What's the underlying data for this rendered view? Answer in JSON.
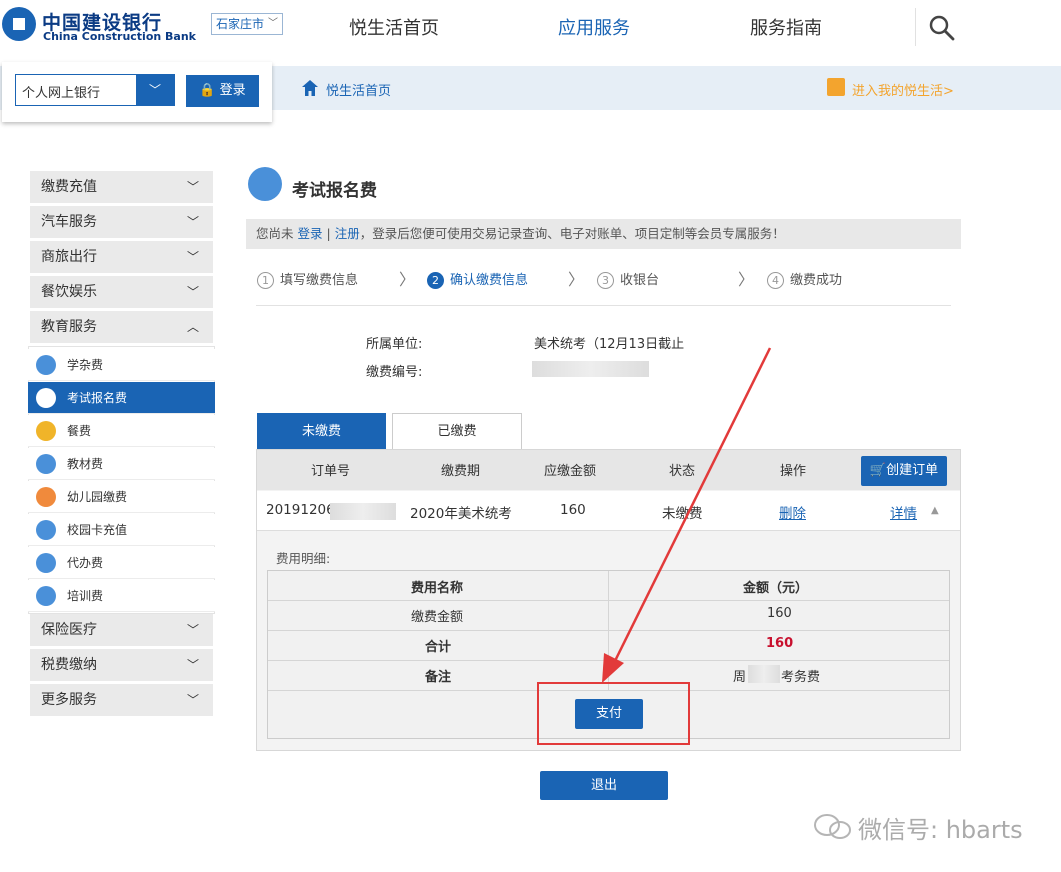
{
  "header": {
    "logo_cn": "中国建设银行",
    "logo_en": "China Construction Bank",
    "city": "石家庄市",
    "nav": [
      "悦生活首页",
      "应用服务",
      "服务指南"
    ]
  },
  "subbar": {
    "bank_type": "个人网上银行",
    "login": "登录",
    "home": "悦生活首页",
    "my_life": "进入我的悦生活>"
  },
  "sidebar": {
    "groups_top": [
      "缴费充值",
      "汽车服务",
      "商旅出行",
      "餐饮娱乐",
      "教育服务"
    ],
    "edu_items": [
      "学杂费",
      "考试报名费",
      "餐费",
      "教材费",
      "幼儿园缴费",
      "校园卡充值",
      "代办费",
      "培训费"
    ],
    "groups_bottom": [
      "保险医疗",
      "税费缴纳",
      "更多服务"
    ]
  },
  "page": {
    "title": "考试报名费",
    "notice_pre": "您尚未",
    "notice_login": "登录",
    "notice_sep": "|",
    "notice_register": "注册",
    "notice_post": "，登录后您便可使用交易记录查询、电子对账单、项目定制等会员专属服务！"
  },
  "steps": [
    {
      "num": "1",
      "label": "填写缴费信息"
    },
    {
      "num": "2",
      "label": "确认缴费信息"
    },
    {
      "num": "3",
      "label": "收银台"
    },
    {
      "num": "4",
      "label": "缴费成功"
    }
  ],
  "info": {
    "unit_label": "所属单位:",
    "unit_value": "美术统考（12月13日截止",
    "code_label": "缴费编号:"
  },
  "tabs": {
    "unpaid": "未缴费",
    "paid": "已缴费"
  },
  "table": {
    "headers": [
      "订单号",
      "缴费期",
      "应缴金额",
      "状态",
      "操作"
    ],
    "create_order": "创建订单",
    "row": {
      "order_prefix": "20191206",
      "period": "2020年美术统考",
      "amount": "160",
      "status": "未缴费",
      "delete": "删除",
      "detail": "详情"
    }
  },
  "detail": {
    "label": "费用明细:",
    "h_name": "费用名称",
    "h_amount": "金额（元）",
    "r1_name": "缴费金额",
    "r1_amount": "160",
    "r2_name": "合计",
    "r2_amount": "160",
    "r3_name": "备注",
    "r3_note_pre": "周",
    "r3_note_post": "考务费",
    "pay": "支付"
  },
  "exit": "退出",
  "watermark": "微信号: hbarts",
  "colors": {
    "primary": "#1a64b4",
    "accent_orange": "#f3a42e",
    "total_red": "#c8102e",
    "annotation_red": "#e23a3a"
  }
}
